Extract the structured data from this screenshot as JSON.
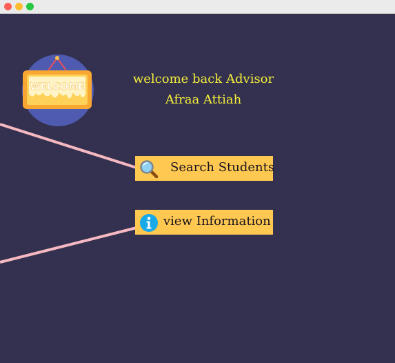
{
  "window": {
    "controls": [
      "close",
      "minimize",
      "maximize"
    ]
  },
  "logo": {
    "text": "WELCOME",
    "icon": "welcome-sign-icon"
  },
  "greeting": {
    "line1": "welcome back Advisor",
    "line2": "Afraa Attiah"
  },
  "actions": {
    "search": {
      "label": "Search Students",
      "icon": "magnifier-icon"
    },
    "info": {
      "label": "view Information",
      "icon": "info-icon"
    }
  },
  "colors": {
    "background": "#33314f",
    "button": "#ffc850",
    "greeting_text": "#f5ef3a",
    "connector_line": "#f7b9c1"
  }
}
